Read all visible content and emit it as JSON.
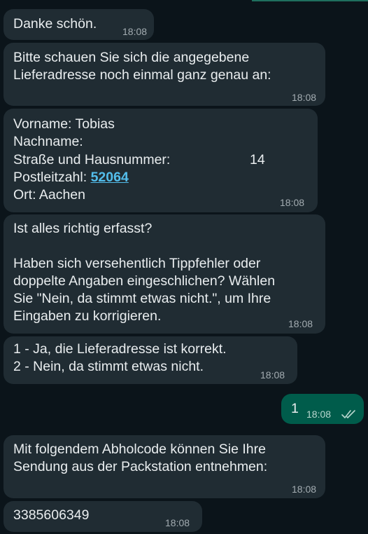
{
  "messages": [
    {
      "id": "m1",
      "direction": "in",
      "text": "Danke schön.",
      "time": "18:08"
    },
    {
      "id": "m2",
      "direction": "in",
      "text": "Bitte schauen Sie sich die angegebene\nLieferadresse noch einmal ganz genau an:",
      "time": "18:08"
    },
    {
      "id": "m3",
      "direction": "in",
      "lines": {
        "first_name": "Vorname: Tobias",
        "last_name": "Nachname:",
        "street_label": "Straße und Hausnummer:",
        "street_number": "14",
        "postal_label": "Postleitzahl: ",
        "postal_code": "52064",
        "city": "Ort: Aachen"
      },
      "time": "18:08"
    },
    {
      "id": "m4",
      "direction": "in",
      "text": "Ist alles richtig erfasst?\n\nHaben sich versehentlich Tippfehler oder\ndoppelte Angaben eingeschlichen? Wählen\nSie \"Nein, da stimmt etwas nicht.\", um Ihre\nEingaben zu korrigieren.",
      "time": "18:08"
    },
    {
      "id": "m5",
      "direction": "in",
      "text": "1 - Ja, die Lieferadresse ist korrekt.\n2 - Nein, da stimmt etwas nicht.",
      "time": "18:08"
    },
    {
      "id": "m6",
      "direction": "out",
      "text": "1",
      "time": "18:08",
      "status": "read",
      "status_icon": "double-check-icon"
    },
    {
      "id": "m7",
      "direction": "in",
      "text": "Mit folgendem Abholcode können Sie Ihre\nSendung aus der Packstation entnehmen:",
      "time": "18:08"
    },
    {
      "id": "m8",
      "direction": "in",
      "text": "3385606349",
      "time": "18:08"
    }
  ],
  "colors": {
    "background": "#0b141a",
    "incoming_bubble": "#202c33",
    "outgoing_bubble": "#005c4b",
    "text": "#e9edef",
    "timestamp": "#a3acb1",
    "link": "#53bdeb"
  }
}
